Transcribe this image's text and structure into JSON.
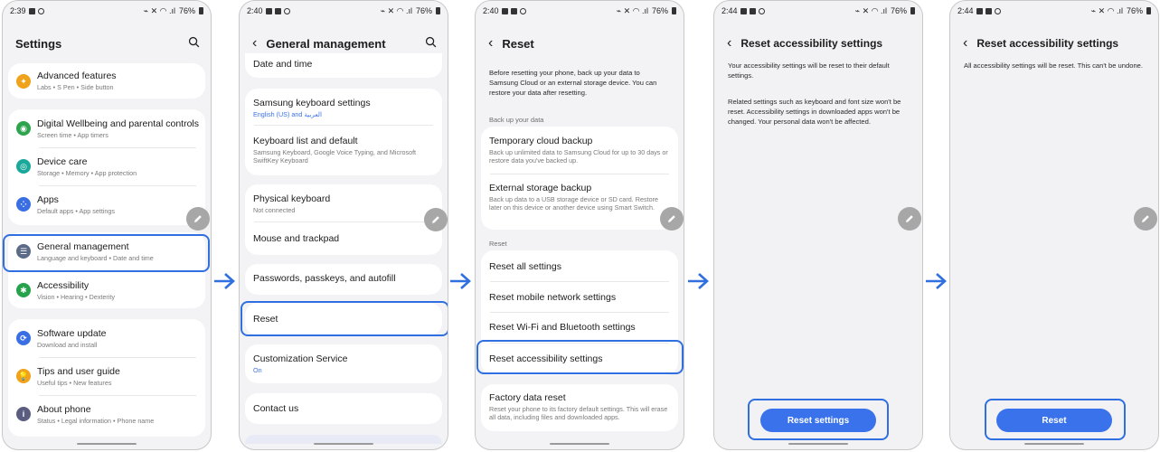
{
  "status": {
    "battery": "76%",
    "times": [
      "2:39",
      "2:40",
      "2:40",
      "2:44",
      "2:44"
    ]
  },
  "screen1": {
    "title": "Settings",
    "items": [
      {
        "label": "Advanced features",
        "sub": "Labs • S Pen • Side button",
        "icon_color": "#f0a21a"
      },
      {
        "label": "Digital Wellbeing and parental controls",
        "sub": "Screen time • App timers",
        "icon_color": "#2ea44f"
      },
      {
        "label": "Device care",
        "sub": "Storage • Memory • App protection",
        "icon_color": "#1aa89a"
      },
      {
        "label": "Apps",
        "sub": "Default apps • App settings",
        "icon_color": "#3a6fe4"
      },
      {
        "label": "General management",
        "sub": "Language and keyboard • Date and time",
        "icon_color": "#5b6a86"
      },
      {
        "label": "Accessibility",
        "sub": "Vision • Hearing • Dexterity",
        "icon_color": "#27a24c"
      },
      {
        "label": "Software update",
        "sub": "Download and install",
        "icon_color": "#3a6fe4"
      },
      {
        "label": "Tips and user guide",
        "sub": "Useful tips • New features",
        "icon_color": "#f0a21a"
      },
      {
        "label": "About phone",
        "sub": "Status • Legal information • Phone name",
        "icon_color": "#5b5d80"
      }
    ]
  },
  "screen2": {
    "title": "General management",
    "items": [
      {
        "label": "Date and time",
        "sub": ""
      },
      {
        "label": "Samsung keyboard settings",
        "sub": "English (US) and العربية"
      },
      {
        "label": "Keyboard list and default",
        "sub": "Samsung Keyboard, Google Voice Typing, and Microsoft SwiftKey Keyboard"
      },
      {
        "label": "Physical keyboard",
        "sub": "Not connected"
      },
      {
        "label": "Mouse and trackpad",
        "sub": ""
      },
      {
        "label": "Passwords, passkeys, and autofill",
        "sub": ""
      },
      {
        "label": "Reset",
        "sub": ""
      },
      {
        "label": "Customization Service",
        "sub": "On"
      },
      {
        "label": "Contact us",
        "sub": ""
      }
    ]
  },
  "screen3": {
    "title": "Reset",
    "intro": "Before resetting your phone, back up your data to Samsung Cloud or an external storage device. You can restore your data after resetting.",
    "backup_header": "Back up your data",
    "backup_items": [
      {
        "label": "Temporary cloud backup",
        "sub": "Back up unlimited data to Samsung Cloud for up to 30 days or restore data you've backed up."
      },
      {
        "label": "External storage backup",
        "sub": "Back up data to a USB storage device or SD card. Restore later on this device or another device using Smart Switch."
      }
    ],
    "reset_header": "Reset",
    "reset_items": [
      {
        "label": "Reset all settings"
      },
      {
        "label": "Reset mobile network settings"
      },
      {
        "label": "Reset Wi-Fi and Bluetooth settings"
      },
      {
        "label": "Reset accessibility settings"
      }
    ],
    "factory": {
      "label": "Factory data reset",
      "sub": "Reset your phone to its factory default settings. This will erase all data, including files and downloaded apps."
    }
  },
  "screen4": {
    "title": "Reset accessibility settings",
    "para1": "Your accessibility settings will be reset to their default settings.",
    "para2": "Related settings such as keyboard and font size won't be reset. Accessibility settings in downloaded apps won't be changed. Your personal data won't be affected.",
    "button": "Reset settings"
  },
  "screen5": {
    "title": "Reset accessibility settings",
    "para1": "All accessibility settings will be reset. This can't be undone.",
    "button": "Reset"
  },
  "colors": {
    "highlight": "#2f6fe0",
    "button": "#3a72ec",
    "arrow": "#2f6fe0"
  }
}
